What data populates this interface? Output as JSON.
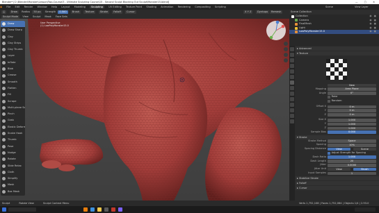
{
  "window": {
    "title": "Blender* [C:\\Blender\\Monster\\Lesson\\Two-Course\\3 - Ultimate Sculpting Course\\15 - Second Sculpt Blocking Out Sculpt\\Monster15.blend]",
    "controls": "—  ▢  ✕"
  },
  "menubar": {
    "items": [
      "File",
      "Edit",
      "Render",
      "Window",
      "Help"
    ],
    "workspaces": [
      "Layout",
      "Modeling",
      "Sculpting",
      "UV Editing",
      "Texture Paint",
      "Shading",
      "Animation",
      "Rendering",
      "Compositing",
      "Scripting"
    ],
    "active_workspace": "Sculpting",
    "scene": "Scene",
    "view_layer": "View Layer"
  },
  "header": {
    "mode": "Sculpt Mode",
    "brush": "Draw",
    "view_items": [
      "View",
      "Sculpt",
      "Mask",
      "Face Sets"
    ],
    "radius_label": "Radius",
    "radius_value": "50 px",
    "strength_label": "Strength",
    "strength_value": "0.500",
    "menus": [
      "Brush",
      "Texture",
      "Stroke",
      "Falloff",
      "Cursor"
    ],
    "right_items": [
      "Dyntopo",
      "Remesh",
      "Options"
    ],
    "symmetry": "X Y Z"
  },
  "viewport": {
    "overlay_view": "User Perspective",
    "overlay_object": "(1) LowPolyMonster15.0"
  },
  "tools": [
    "Draw",
    "Draw Sharp",
    "Clay",
    "Clay Strips",
    "Clay Thumb",
    "Layer",
    "Inflate",
    "Blob",
    "Crease",
    "Smooth",
    "Flatten",
    "Fill",
    "Scrape",
    "Multi-plane Scrape",
    "Pinch",
    "Grab",
    "Elastic Deform",
    "Snake Hook",
    "Thumb",
    "Pose",
    "Nudge",
    "Rotate",
    "Slide Relax",
    "Cloth",
    "Simplify",
    "Mask",
    "Box Mask"
  ],
  "outliner": {
    "title": "Scene Collection",
    "items": [
      {
        "name": "Collection",
        "color": "#ffffff"
      },
      {
        "name": "Camera",
        "color": "#6aa84f"
      },
      {
        "name": "FinalMesh",
        "color": "#e69138"
      },
      {
        "name": "Light",
        "color": "#f1c232"
      },
      {
        "name": "LowPolyMonster15.0",
        "color": "#e69138"
      }
    ],
    "selected_index": 4
  },
  "properties": {
    "sections": {
      "advanced": "Advanced",
      "texture": "Texture",
      "new_texture": "New",
      "stroke": "Stroke",
      "falloff": "Falloff",
      "cursor": "Cursor",
      "display": "Display"
    },
    "mapping_label": "Mapping",
    "mapping_value": "Area Plane",
    "angle_label": "Angle",
    "angle_value": "0°",
    "rake_label": "Rake",
    "random_label": "Random",
    "offset_label": "Offset X",
    "offset_x": "0 m",
    "offset_y": "0 m",
    "offset_z": "0 m",
    "size_label": "Size X",
    "size_x": "1.000",
    "size_y": "1.000",
    "size_z": "1.000",
    "sample_bias_label": "Sample Bias",
    "sample_bias_value": "0.000",
    "stroke_method_label": "Stroke Method",
    "stroke_method_value": "Space",
    "spacing_label": "Spacing",
    "spacing_value": "10%",
    "spacing_dist_label": "Spacing Distance",
    "spacing_dist_value_a": "View",
    "spacing_dist_value_b": "Scene",
    "adjust_strength": "Adjust Strength for Spacing",
    "dash_ratio_label": "Dash Ratio",
    "dash_ratio_value": "1.000",
    "dash_length_label": "Dash Length",
    "dash_length_value": "20",
    "jitter_label": "Jitter",
    "jitter_value": "0.0000",
    "jitter_unit_label": "Jitter Unit",
    "jitter_unit_a": "View",
    "jitter_unit_b": "Brush",
    "input_samples_label": "Input Samples",
    "input_samples_value": "1",
    "stabilize": "Stabilize Stroke"
  },
  "statusbar": {
    "items": [
      "Sculpt",
      "Rotate View",
      "Sculpt Context Menu"
    ],
    "stats": "Verts 1,752,108 | Faces 1,752,064 | Objects 1/4 | 2.93.0"
  },
  "colors": {
    "skin": "#a23d3a",
    "skin_dark": "#6e2624",
    "accent_blue": "#4772b3",
    "bg_gray": "#4a4a4a"
  }
}
